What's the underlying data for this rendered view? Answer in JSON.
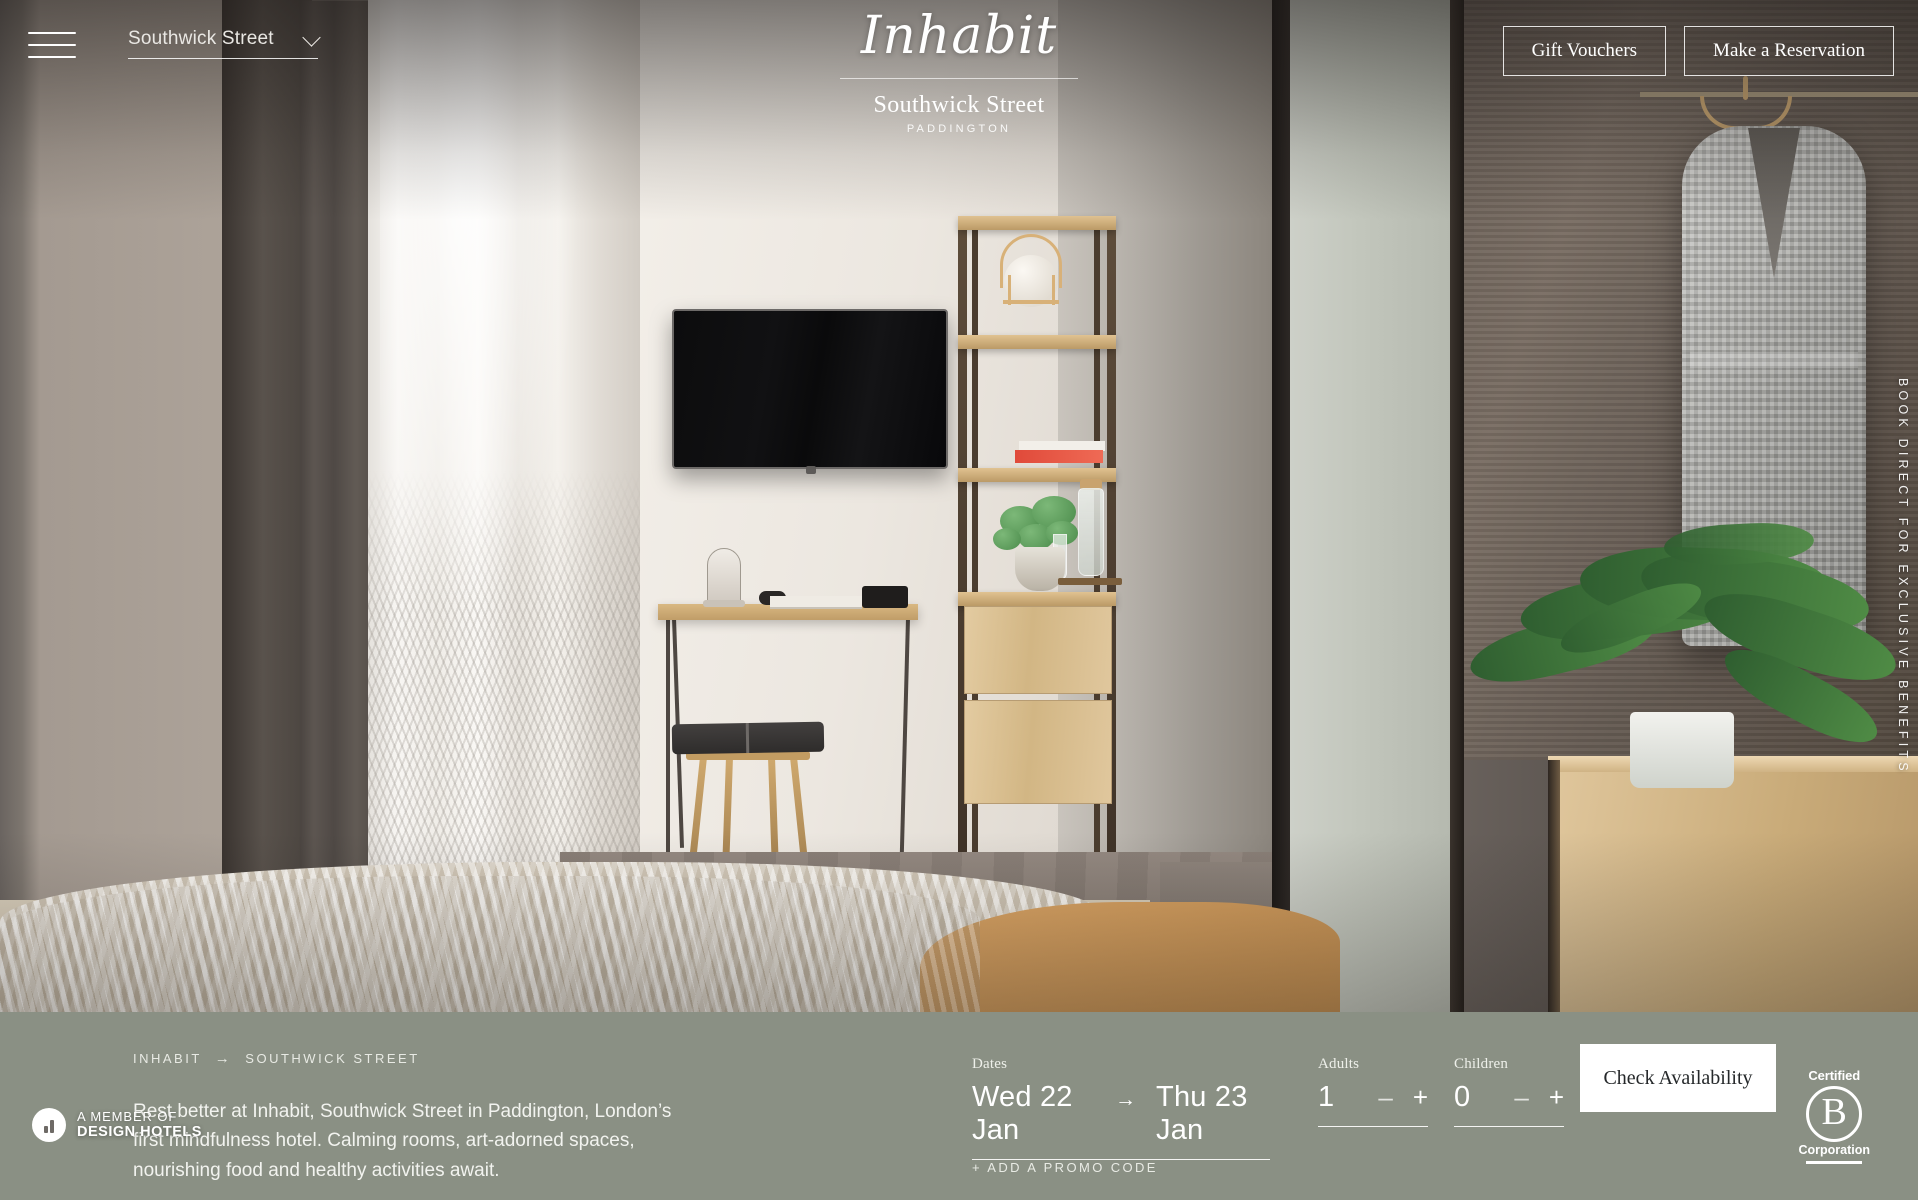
{
  "header": {
    "menu_icon": "hamburger-menu-icon",
    "hotel_selector": {
      "value": "Southwick Street",
      "chevron": "chevron-down-icon"
    },
    "brand": {
      "logo_text": "Inhabit",
      "property": "Southwick Street",
      "location": "PADDINGTON"
    },
    "buttons": {
      "gift_vouchers": "Gift Vouchers",
      "make_reservation": "Make a Reservation"
    }
  },
  "hero": {
    "vertical_tagline": "BOOK DIRECT FOR EXCLUSIVE BENEFITS",
    "design_hotels": {
      "line1": "A MEMBER OF",
      "line2": "DESIGN HOTELS",
      "icon": "design-hotels-mark-icon"
    },
    "b_corp": {
      "top": "Certified",
      "letter": "B",
      "bottom": "Corporation"
    }
  },
  "booking": {
    "breadcrumb": {
      "brand": "INHABIT",
      "arrow": "→",
      "property": "SOUTHWICK STREET"
    },
    "description": "Rest better at Inhabit, Southwick Street in Paddington, London’s first mindfulness hotel. Calming rooms, art-adorned spaces, nourishing food and healthy activities await.",
    "dates": {
      "label": "Dates",
      "check_in": "Wed 22 Jan",
      "arrow": "→",
      "check_out": "Thu 23 Jan"
    },
    "adults": {
      "label": "Adults",
      "value": "1",
      "minus": "–",
      "plus": "+"
    },
    "children": {
      "label": "Children",
      "value": "0",
      "minus": "–",
      "plus": "+"
    },
    "promo_code": "+ ADD A PROMO CODE",
    "cta": "Check Availability"
  },
  "colors": {
    "bar_background": "#8a9084",
    "cta_background": "#ffffff",
    "text_on_photo": "#ffffff"
  }
}
